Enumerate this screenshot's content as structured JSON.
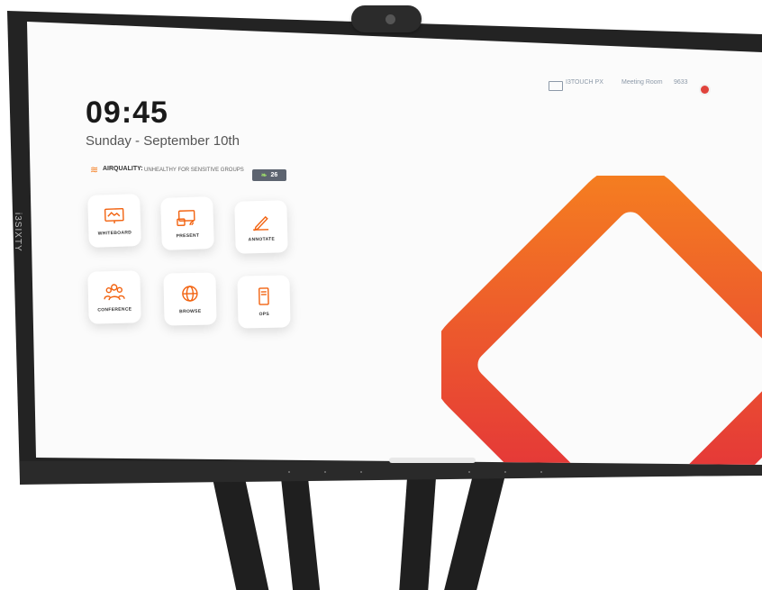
{
  "device": {
    "side_label": "i3SIXTY",
    "camera_icon": "webcam-icon"
  },
  "home": {
    "time": "09:45",
    "date": "Sunday - September 10th"
  },
  "status_bar": {
    "device_name": "I3TOUCH PX",
    "room": "Meeting Room",
    "extra": "9633"
  },
  "air_quality": {
    "label": "AIRQUALITY:",
    "status": "UNHEALTHY FOR SENSITIVE GROUPS",
    "value": "26",
    "accent_color": "#f57e20"
  },
  "apps": [
    {
      "label": "WHITEBOARD",
      "icon": "whiteboard-icon"
    },
    {
      "label": "PRESENT",
      "icon": "present-icon"
    },
    {
      "label": "ANNOTATE",
      "icon": "pencil-icon"
    },
    {
      "label": "CONFERENCE",
      "icon": "people-icon"
    },
    {
      "label": "BROWSE",
      "icon": "globe-icon"
    },
    {
      "label": "OPS",
      "icon": "ops-icon"
    }
  ],
  "colors": {
    "brand_orange": "#f57e20",
    "brand_red": "#e0243f",
    "bezel": "#232323"
  }
}
